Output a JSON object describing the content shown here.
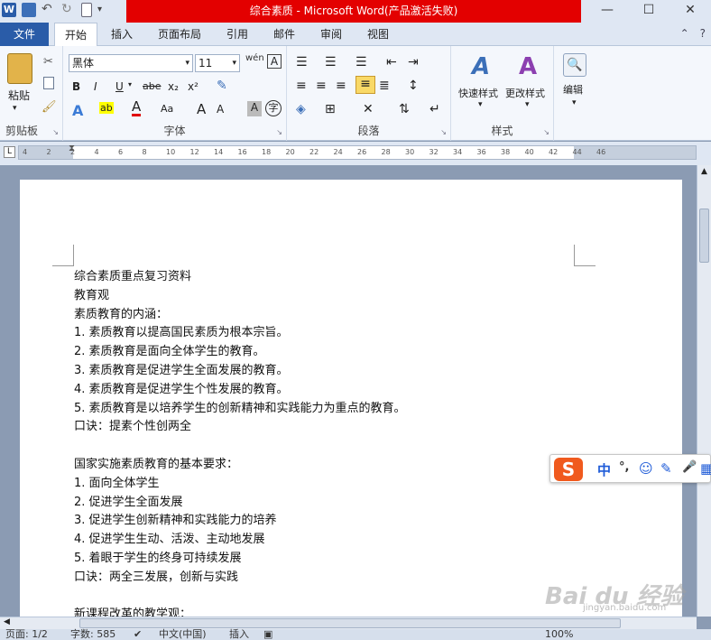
{
  "window": {
    "title": "综合素质 - Microsoft Word(产品激活失败)",
    "controls": {
      "minimize": "—",
      "maximize": "☐",
      "close": "✕"
    }
  },
  "tabs": {
    "file": "文件",
    "items": [
      "开始",
      "插入",
      "页面布局",
      "引用",
      "邮件",
      "审阅",
      "视图"
    ],
    "active": "开始",
    "help": "?"
  },
  "ribbon": {
    "clipboard": {
      "label": "剪贴板",
      "paste": "粘贴"
    },
    "font": {
      "label": "字体",
      "font_name": "黑体",
      "font_size": "11",
      "wen": "wén",
      "bold": "B",
      "italic": "I",
      "underline": "U",
      "strike": "abe",
      "subscript": "x₂",
      "superscript": "x²",
      "grow": "A",
      "shrink": "A",
      "case": "Aa",
      "text_effect": "A",
      "highlight": "ab",
      "font_color": "A",
      "char_shade": "A",
      "enclose": "字",
      "border_char": "A"
    },
    "paragraph": {
      "label": "段落"
    },
    "styles": {
      "label": "样式",
      "quick": "快速样式",
      "change": "更改样式"
    },
    "editing": {
      "label": "编辑"
    }
  },
  "ruler": {
    "ticks": [
      "4",
      "2",
      "2",
      "4",
      "6",
      "8",
      "10",
      "12",
      "14",
      "16",
      "18",
      "20",
      "22",
      "24",
      "26",
      "28",
      "30",
      "32",
      "34",
      "36",
      "38",
      "40",
      "42",
      "44",
      "46"
    ]
  },
  "document": {
    "lines": [
      "综合素质重点复习资料",
      "教育观",
      "素质教育的内涵：",
      "1. 素质教育以提高国民素质为根本宗旨。",
      "2. 素质教育是面向全体学生的教育。",
      "3. 素质教育是促进学生全面发展的教育。",
      "4. 素质教育是促进学生个性发展的教育。",
      "5. 素质教育是以培养学生的创新精神和实践能力为重点的教育。",
      "口诀：提素个性创两全",
      "",
      "国家实施素质教育的基本要求：",
      "1. 面向全体学生",
      "2. 促进学生全面发展",
      "3. 促进学生创新精神和实践能力的培养",
      "4. 促进学生生动、活泼、主动地发展",
      "5. 着眼于学生的终身可持续发展",
      "口诀：两全三发展，创新与实践",
      "",
      "新课程改革的教学观："
    ]
  },
  "statusbar": {
    "page": "页面: 1/2",
    "words": "字数: 585",
    "lang": "中文(中国)",
    "mode": "插入",
    "zoom": "100%"
  },
  "ime": {
    "logo": "S",
    "items": [
      "中",
      "°,",
      "☺",
      "✎",
      "🎤",
      "▦"
    ]
  },
  "watermark": {
    "text": "Bai du 经验",
    "url": "jingyan.baidu.com"
  }
}
